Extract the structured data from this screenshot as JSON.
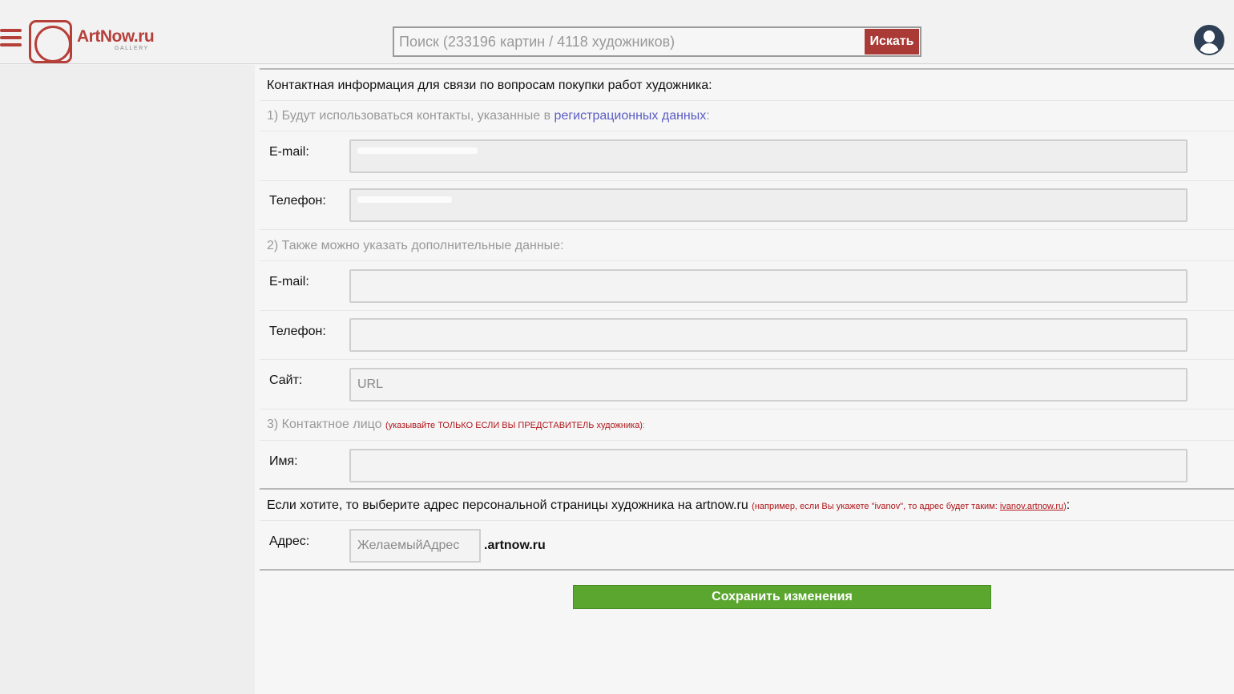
{
  "header": {
    "logo_text": "ArtNow.ru",
    "logo_sub": "GALLERY",
    "search_placeholder": "Поиск (233196 картин / 4118 художников)",
    "search_button": "Искать",
    "hamburger_icon": "menu-icon",
    "user_icon": "user-avatar-icon"
  },
  "form": {
    "intro": "Контактная информация для связи по вопросам покупки работ художника:",
    "section1_prefix": "1) Будут использоваться контакты, указанные в ",
    "section1_link": "регистрационных данных",
    "section1_suffix": ":",
    "email_label": "E-mail:",
    "phone_label": "Телефон:",
    "section2": "2) Также можно указать дополнительные данные:",
    "email2_label": "E-mail:",
    "phone2_label": "Телефон:",
    "site_label": "Сайт:",
    "site_placeholder": "URL",
    "section3_prefix": "3) Контактное лицо ",
    "section3_note": "(указывайте ТОЛЬКО ЕСЛИ ВЫ ПРЕДСТАВИТЕЛЬ художника)",
    "section3_suffix": ":",
    "name_label": "Имя:",
    "address_intro": "Если хотите, то выберите адрес персональной страницы художника на artnow.ru ",
    "address_note": "(например, если Вы укажете \"ivanov\", то адрес будет таким: ",
    "address_note_link": "ivanov.artnow.ru",
    "address_note_end": ")",
    "address_end": ":",
    "address_label": "Адрес:",
    "address_placeholder": "ЖелаемыйАдрес",
    "address_suffix": ".artnow.ru",
    "save_button": "Сохранить изменения"
  },
  "colors": {
    "brand": "#b5403a",
    "search_button": "#a93a36",
    "save_button": "#5aa62e",
    "link": "#5a5cc4",
    "note_red": "#b0161a"
  }
}
